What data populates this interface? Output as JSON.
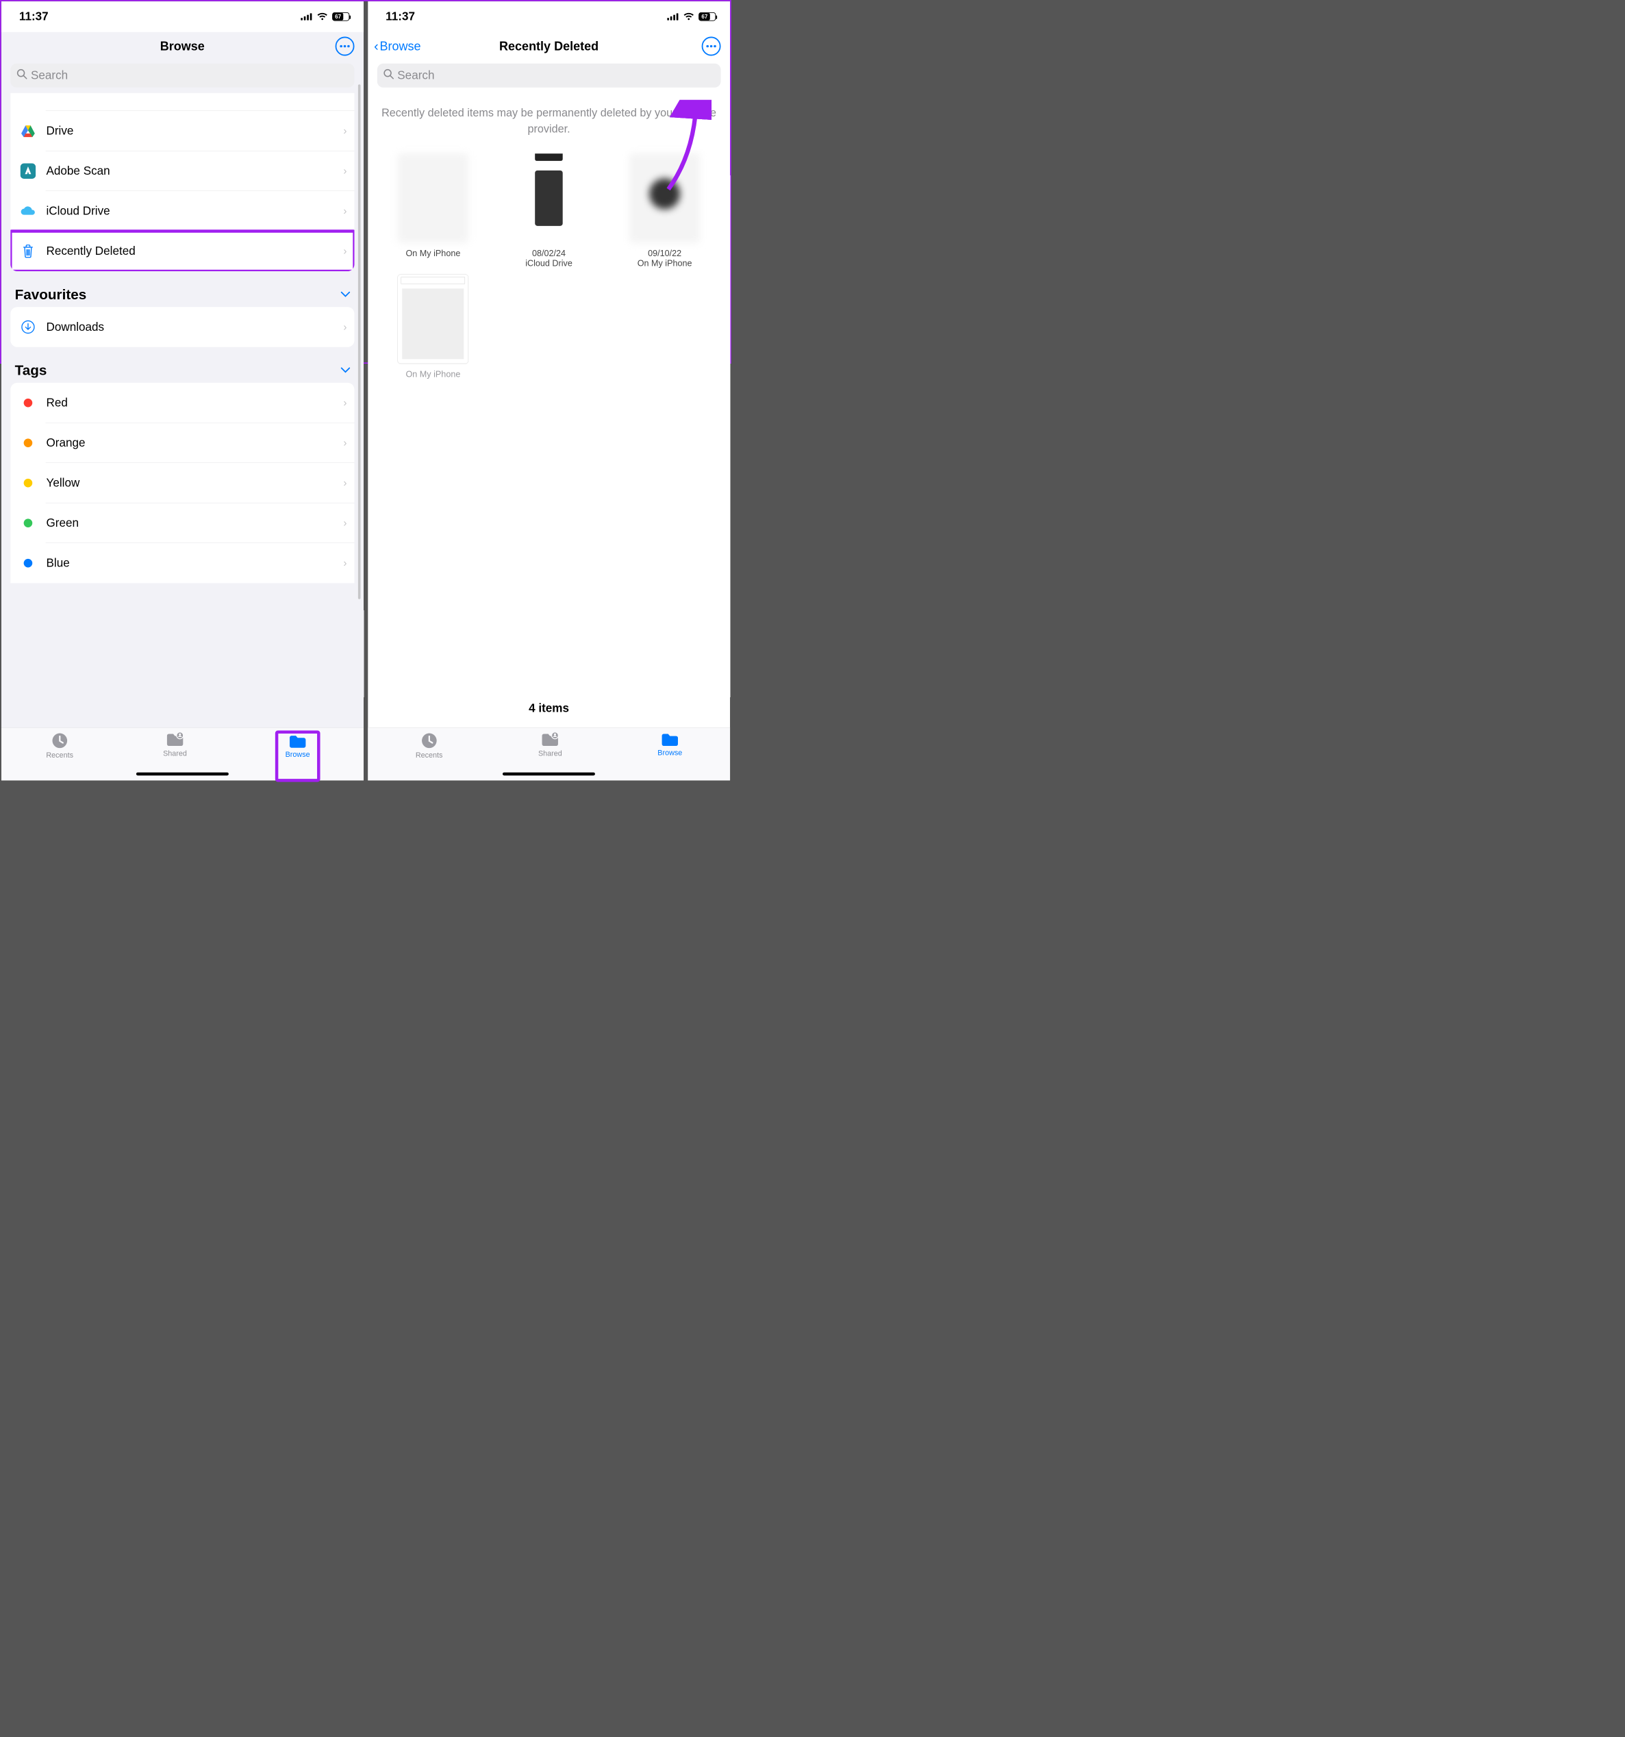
{
  "status": {
    "time": "11:37",
    "battery_pct": "67"
  },
  "left": {
    "title": "Browse",
    "search_placeholder": "Search",
    "locations": [
      {
        "label": "Drive",
        "icon": "drive"
      },
      {
        "label": "Adobe Scan",
        "icon": "adobe"
      },
      {
        "label": "iCloud Drive",
        "icon": "icloud"
      },
      {
        "label": "Recently Deleted",
        "icon": "trash",
        "hl": true
      }
    ],
    "sections": {
      "favourites": {
        "title": "Favourites",
        "items": [
          {
            "label": "Downloads",
            "icon": "download"
          }
        ]
      },
      "tags": {
        "title": "Tags",
        "items": [
          {
            "label": "Red",
            "color": "#ff3b30"
          },
          {
            "label": "Orange",
            "color": "#ff9500"
          },
          {
            "label": "Yellow",
            "color": "#ffcc00"
          },
          {
            "label": "Green",
            "color": "#34c759"
          },
          {
            "label": "Blue",
            "color": "#007aff"
          }
        ]
      }
    }
  },
  "right": {
    "back_label": "Browse",
    "title": "Recently Deleted",
    "search_placeholder": "Search",
    "notice": "Recently deleted items may be permanently deleted by your storage provider.",
    "items": [
      {
        "date": "",
        "location": "On My iPhone"
      },
      {
        "date": "08/02/24",
        "location": "iCloud Drive"
      },
      {
        "date": "09/10/22",
        "location": "On My iPhone"
      },
      {
        "date": "",
        "location": "On My iPhone"
      }
    ],
    "count": "4 items"
  },
  "tabs": {
    "recents": "Recents",
    "shared": "Shared",
    "browse": "Browse"
  }
}
